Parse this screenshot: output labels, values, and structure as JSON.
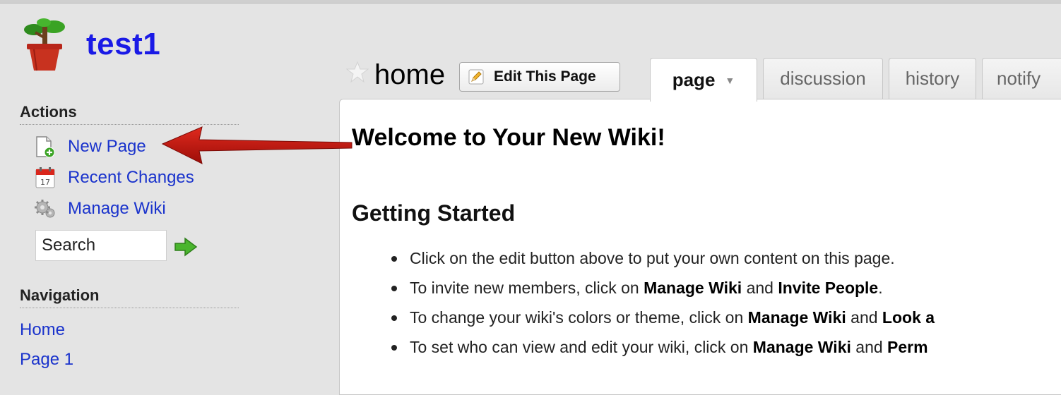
{
  "site": {
    "title": "test1"
  },
  "sidebar": {
    "actions_heading": "Actions",
    "actions": [
      {
        "label": "New Page",
        "icon": "new-page-icon"
      },
      {
        "label": "Recent Changes",
        "icon": "calendar-icon"
      },
      {
        "label": "Manage Wiki",
        "icon": "gear-icon"
      }
    ],
    "calendar_day": "17",
    "search": {
      "value": "Search"
    },
    "navigation_heading": "Navigation",
    "navigation": [
      {
        "label": "Home"
      },
      {
        "label": "Page 1"
      }
    ]
  },
  "page": {
    "name": "home",
    "edit_button": "Edit This Page",
    "tabs": [
      {
        "label": "page",
        "active": true
      },
      {
        "label": "discussion"
      },
      {
        "label": "history"
      },
      {
        "label": "notify"
      }
    ]
  },
  "content": {
    "heading": "Welcome to Your New Wiki!",
    "subheading": "Getting Started",
    "bullets": [
      {
        "before": "Click on the edit button above to put your own content on this page.",
        "b1": "",
        "mid": "",
        "b2": "",
        "after": ""
      },
      {
        "before": "To invite new members, click on ",
        "b1": "Manage Wiki",
        "mid": " and ",
        "b2": "Invite People",
        "after": "."
      },
      {
        "before": "To change your wiki's colors or theme, click on ",
        "b1": "Manage Wiki",
        "mid": " and ",
        "b2": "Look a",
        "after": ""
      },
      {
        "before": "To set who can view and edit your wiki, click on ",
        "b1": "Manage Wiki",
        "mid": " and ",
        "b2": "Perm",
        "after": ""
      }
    ]
  },
  "colors": {
    "link": "#1a33cc",
    "title": "#1a1ae6",
    "annotation_arrow": "#c00000",
    "background": "#e4e4e4"
  }
}
